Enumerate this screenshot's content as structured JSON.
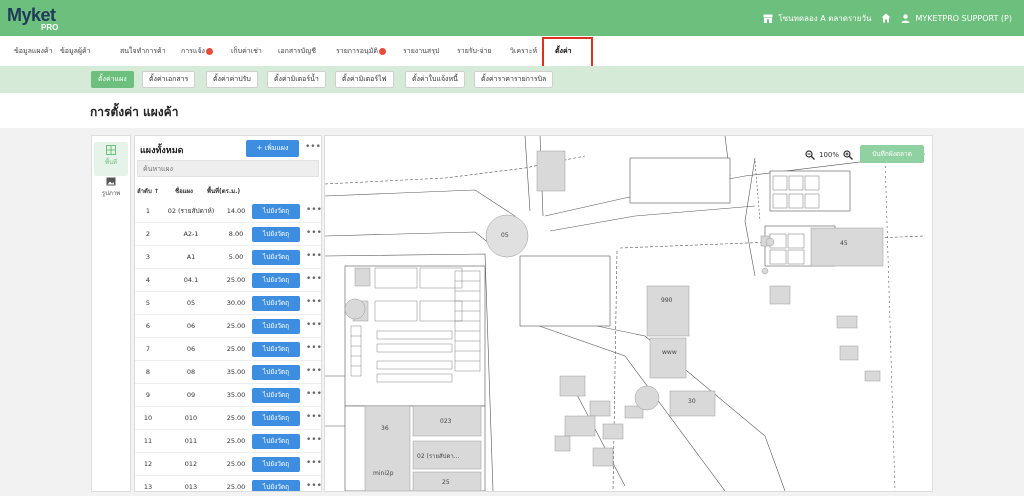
{
  "app": {
    "logo_text": "Myket",
    "logo_sub": "PRO"
  },
  "topbar": {
    "market_name": "โซนทดลอง A ตลาดรายวัน",
    "user": "MYKETPRO SUPPORT (P)"
  },
  "mainmenu": {
    "items": [
      {
        "label": "ข้อมูลแผงค้า"
      },
      {
        "label": "ข้อมูลผู้ค้า"
      },
      {
        "label": "สนใจทำการค้า"
      },
      {
        "label": "การแจ้ง",
        "badge": true
      },
      {
        "label": "เก็บค่าเช่า"
      },
      {
        "label": "เอกสารบัญชี"
      },
      {
        "label": "รายการอนุมัติ",
        "badge": true
      },
      {
        "label": "รายงานสรุป"
      },
      {
        "label": "รายรับ-จ่าย"
      },
      {
        "label": "วิเคราะห์"
      },
      {
        "label": "ตั้งค่า",
        "active": true
      }
    ]
  },
  "submenu": {
    "items": [
      {
        "label": "ตั้งค่าแผง",
        "active": true
      },
      {
        "label": "ตั้งค่าเอกสาร"
      },
      {
        "label": "ตั้งค่าค่าปรับ"
      },
      {
        "label": "ตั้งค่ามิเตอร์น้ำ"
      },
      {
        "label": "ตั้งค่ามิเตอร์ไฟ"
      },
      {
        "label": "ตั้งค่าใบแจ้งหนี้"
      },
      {
        "label": "ตั้งค่าราคารายการบิล"
      }
    ]
  },
  "page": {
    "title": "การตั้งค่า แผงค้า"
  },
  "rail": {
    "items": [
      {
        "label": "พื้นที่",
        "icon": "grid-icon"
      },
      {
        "label": "รูปภาพ",
        "icon": "image-icon"
      }
    ]
  },
  "panel": {
    "title": "แผงทั้งหมด",
    "add_label": "+ เพิ่มแผง",
    "search_placeholder": "ค้นหาแผง",
    "columns": {
      "order": "ลำดับ ↑",
      "name": "ชื่อแผง",
      "area": "พื้นที่(ตร.ม.)"
    },
    "go_label": "ไปยังวัตถุ",
    "rows": [
      {
        "no": "1",
        "name": "02 (รายสัปดาห์)",
        "area": "14.00"
      },
      {
        "no": "2",
        "name": "A2-1",
        "area": "8.00"
      },
      {
        "no": "3",
        "name": "A1",
        "area": "5.00"
      },
      {
        "no": "4",
        "name": "04.1",
        "area": "25.00"
      },
      {
        "no": "5",
        "name": "05",
        "area": "30.00"
      },
      {
        "no": "6",
        "name": "06",
        "area": "25.00"
      },
      {
        "no": "7",
        "name": "06",
        "area": "25.00"
      },
      {
        "no": "8",
        "name": "08",
        "area": "35.00"
      },
      {
        "no": "9",
        "name": "09",
        "area": "35.00"
      },
      {
        "no": "10",
        "name": "010",
        "area": "25.00"
      },
      {
        "no": "11",
        "name": "011",
        "area": "25.00"
      },
      {
        "no": "12",
        "name": "012",
        "area": "25.00"
      },
      {
        "no": "13",
        "name": "013",
        "area": "25.00"
      }
    ]
  },
  "map": {
    "zoom": "100%",
    "save_label": "บันทึกผังตลาด",
    "labels": {
      "roundabout": "05",
      "s990": "990",
      "www": "www",
      "s30": "30",
      "s45": "45",
      "s36": "36",
      "s023": "023",
      "s02": "02 (รายสัปดา...",
      "mini": "mini2p",
      "s25": "25"
    }
  }
}
